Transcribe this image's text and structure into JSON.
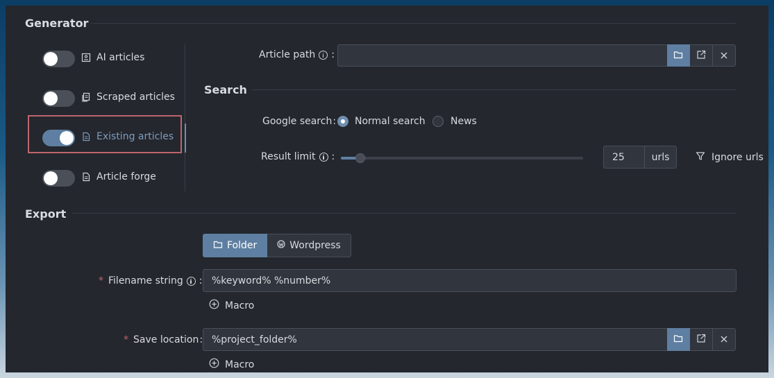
{
  "generator": {
    "title": "Generator",
    "items": [
      {
        "label": "AI articles",
        "enabled": false,
        "icon": "image-doc-icon"
      },
      {
        "label": "Scraped articles",
        "enabled": false,
        "icon": "copy-doc-icon"
      },
      {
        "label": "Existing articles",
        "enabled": true,
        "icon": "doc-icon",
        "active": true
      },
      {
        "label": "Article forge",
        "enabled": false,
        "icon": "doc-icon"
      }
    ]
  },
  "article_path": {
    "label": "Article path",
    "colon": ":",
    "value": ""
  },
  "search": {
    "title": "Search",
    "google_label": "Google search",
    "colon": ":",
    "options": [
      "Normal search",
      "News"
    ],
    "selected": "Normal search",
    "result_limit_label": "Result limit",
    "result_limit_value": "25",
    "result_limit_unit": "urls",
    "slider_fraction": 0.08,
    "ignore_urls_label": "Ignore urls"
  },
  "export": {
    "title": "Export",
    "tabs": [
      "Folder",
      "Wordpress"
    ],
    "active_tab": "Folder",
    "filename_label": "Filename string",
    "filename_value": "%keyword% %number%",
    "macro_label": "Macro",
    "save_location_label": "Save location",
    "save_location_value": "%project_folder%",
    "colon": ":"
  },
  "colors": {
    "accent": "#5e7fa1",
    "highlight": "#c0666c",
    "panel": "#24272e"
  }
}
